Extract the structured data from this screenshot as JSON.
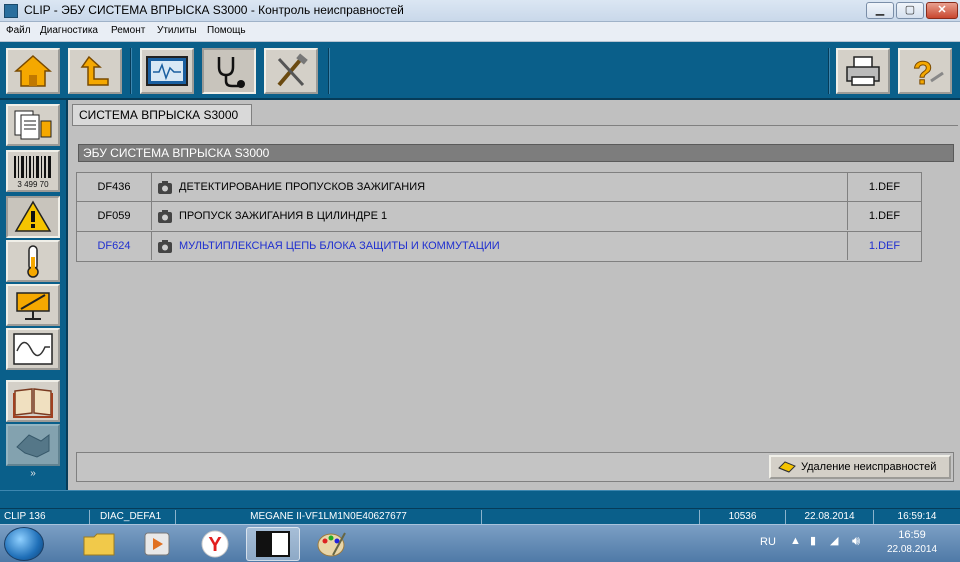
{
  "window": {
    "title": "CLIP - ЭБУ СИСТЕМА ВПРЫСКА S3000 - Контроль неисправностей",
    "minimize": "▁",
    "maximize": "▢",
    "close": "✕"
  },
  "menu": [
    "Файл",
    "Диагностика",
    "Ремонт",
    "Утилиты",
    "Помощь"
  ],
  "toolbar": {
    "buttons": [
      "home-icon",
      "back-up-icon",
      "oscilloscope-icon",
      "stethoscope-icon",
      "tools-icon",
      "printer-icon",
      "help-icon"
    ]
  },
  "sidebar": {
    "buttons": [
      "documents-icon",
      "barcode-icon",
      "warning-icon",
      "thermometer-icon",
      "actuator-icon",
      "signal-graph-icon",
      "book-icon",
      "repair-icon"
    ],
    "barcode_text": "3 499 70",
    "scroll": "»"
  },
  "main": {
    "tab_label": "СИСТЕМА ВПРЫСКА S3000",
    "section_header": "ЭБУ СИСТЕМА ВПРЫСКА S3000",
    "faults": [
      {
        "code": "DF436",
        "description": "ДЕТЕКТИРОВАНИЕ ПРОПУСКОВ ЗАЖИГАНИЯ",
        "status": "1.DEF"
      },
      {
        "code": "DF059",
        "description": "ПРОПУСК ЗАЖИГАНИЯ В ЦИЛИНДРЕ 1",
        "status": "1.DEF"
      },
      {
        "code": "DF624",
        "description": "МУЛЬТИПЛЕКСНАЯ ЦЕПЬ БЛОКА ЗАЩИТЫ И КОММУТАЦИИ",
        "status": "1.DEF"
      }
    ],
    "clear_button": "Удаление неисправностей"
  },
  "statusbar": {
    "device": "CLIP 136",
    "diag": "DIAC_DEFA1",
    "vehicle": "MEGANE II-VF1LM1N0E40627677",
    "number": "10536",
    "date": "22.08.2014",
    "time": "16:59:14"
  },
  "taskbar": {
    "language": "RU",
    "clock_time": "16:59",
    "clock_date": "22.08.2014"
  }
}
